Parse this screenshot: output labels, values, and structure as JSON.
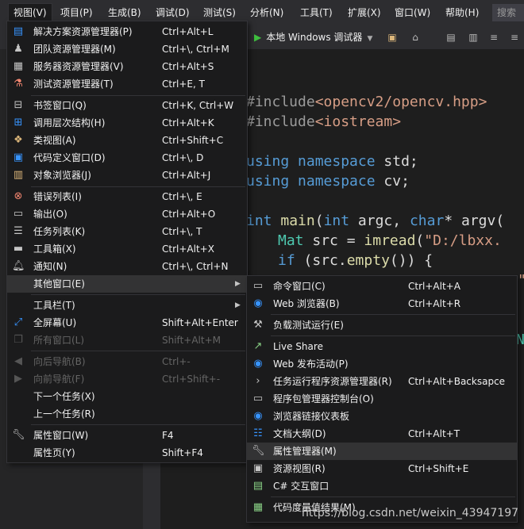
{
  "menubar": {
    "items": [
      "视图(V)",
      "项目(P)",
      "生成(B)",
      "调试(D)",
      "测试(S)",
      "分析(N)",
      "工具(T)",
      "扩展(X)",
      "窗口(W)",
      "帮助(H)"
    ],
    "search": "搜索"
  },
  "toolbar": {
    "run_target": "本地 Windows 调试器"
  },
  "editor": {
    "lines": [
      {
        "a": "#include",
        "b": "<opencv2/opencv.hpp>"
      },
      {
        "a": "#include",
        "b": "<iostream>"
      },
      {
        "a": "using",
        "b": "namespace",
        "c": "std;"
      },
      {
        "a": "using",
        "b": "namespace",
        "c": "cv;"
      },
      {
        "a": "int",
        "b": "main",
        "c": "(",
        "d": "int",
        "e": "argc,",
        "f": "char",
        "g": "* argv("
      },
      {
        "a": "Mat",
        "b": "src = ",
        "c": "imread",
        "d": "(",
        "e": "\"D:/lbxx."
      },
      {
        "a": "if",
        "b": "(src.",
        "c": "empty",
        "d": "()) {"
      }
    ],
    "fragment_1": "\"",
    "fragment_2": "N"
  },
  "view_menu": {
    "items": [
      {
        "label": "解决方案资源管理器(P)",
        "shortcut": "Ctrl+Alt+L",
        "icon": "solution-explorer-icon"
      },
      {
        "label": "团队资源管理器(M)",
        "shortcut": "Ctrl+\\, Ctrl+M",
        "icon": "team-explorer-icon"
      },
      {
        "label": "服务器资源管理器(V)",
        "shortcut": "Ctrl+Alt+S",
        "icon": "server-explorer-icon"
      },
      {
        "label": "测试资源管理器(T)",
        "shortcut": "Ctrl+E, T",
        "icon": "test-explorer-icon"
      },
      {
        "label": "书签窗口(Q)",
        "shortcut": "Ctrl+K, Ctrl+W",
        "icon": "bookmark-icon"
      },
      {
        "label": "调用层次结构(H)",
        "shortcut": "Ctrl+Alt+K",
        "icon": "call-hierarchy-icon"
      },
      {
        "label": "类视图(A)",
        "shortcut": "Ctrl+Shift+C",
        "icon": "class-view-icon"
      },
      {
        "label": "代码定义窗口(D)",
        "shortcut": "Ctrl+\\, D",
        "icon": "code-definition-icon"
      },
      {
        "label": "对象浏览器(J)",
        "shortcut": "Ctrl+Alt+J",
        "icon": "object-browser-icon"
      },
      {
        "label": "错误列表(I)",
        "shortcut": "Ctrl+\\, E",
        "icon": "error-list-icon"
      },
      {
        "label": "输出(O)",
        "shortcut": "Ctrl+Alt+O",
        "icon": "output-icon"
      },
      {
        "label": "任务列表(K)",
        "shortcut": "Ctrl+\\, T",
        "icon": "task-list-icon"
      },
      {
        "label": "工具箱(X)",
        "shortcut": "Ctrl+Alt+X",
        "icon": "toolbox-icon"
      },
      {
        "label": "通知(N)",
        "shortcut": "Ctrl+\\, Ctrl+N",
        "icon": "notification-icon"
      },
      {
        "label": "其他窗口(E)",
        "shortcut": "",
        "icon": ""
      },
      {
        "label": "工具栏(T)",
        "shortcut": "",
        "icon": ""
      },
      {
        "label": "全屏幕(U)",
        "shortcut": "Shift+Alt+Enter",
        "icon": "fullscreen-icon"
      },
      {
        "label": "所有窗口(L)",
        "shortcut": "Shift+Alt+M",
        "icon": "all-windows-icon"
      },
      {
        "label": "向后导航(B)",
        "shortcut": "Ctrl+-",
        "icon": "navigate-back-icon"
      },
      {
        "label": "向前导航(F)",
        "shortcut": "Ctrl+Shift+-",
        "icon": "navigate-forward-icon"
      },
      {
        "label": "下一个任务(X)",
        "shortcut": "",
        "icon": ""
      },
      {
        "label": "上一个任务(R)",
        "shortcut": "",
        "icon": ""
      },
      {
        "label": "属性窗口(W)",
        "shortcut": "F4",
        "icon": "properties-window-icon"
      },
      {
        "label": "属性页(Y)",
        "shortcut": "Shift+F4",
        "icon": ""
      }
    ]
  },
  "other_windows_menu": {
    "items": [
      {
        "label": "命令窗口(C)",
        "shortcut": "Ctrl+Alt+A",
        "icon": "command-window-icon"
      },
      {
        "label": "Web 浏览器(B)",
        "shortcut": "Ctrl+Alt+R",
        "icon": "web-browser-icon"
      },
      {
        "label": "负载测试运行(E)",
        "shortcut": "",
        "icon": "load-test-icon"
      },
      {
        "label": "Live Share",
        "shortcut": "",
        "icon": "live-share-icon"
      },
      {
        "label": "Web 发布活动(P)",
        "shortcut": "",
        "icon": "web-publish-icon"
      },
      {
        "label": "任务运行程序资源管理器(R)",
        "shortcut": "Ctrl+Alt+Backsapce",
        "icon": "task-runner-icon"
      },
      {
        "label": "程序包管理器控制台(O)",
        "shortcut": "",
        "icon": "package-manager-icon"
      },
      {
        "label": "浏览器链接仪表板",
        "shortcut": "",
        "icon": "browser-link-icon"
      },
      {
        "label": "文档大纲(D)",
        "shortcut": "Ctrl+Alt+T",
        "icon": "document-outline-icon"
      },
      {
        "label": "属性管理器(M)",
        "shortcut": "",
        "icon": "property-manager-icon"
      },
      {
        "label": "资源视图(R)",
        "shortcut": "Ctrl+Shift+E",
        "icon": "resource-view-icon"
      },
      {
        "label": "C# 交互窗口",
        "shortcut": "",
        "icon": "csharp-interactive-icon"
      },
      {
        "label": "代码度量值结果(M)",
        "shortcut": "",
        "icon": "code-metrics-icon"
      }
    ]
  },
  "watermark": "https://blog.csdn.net/weixin_43947197"
}
